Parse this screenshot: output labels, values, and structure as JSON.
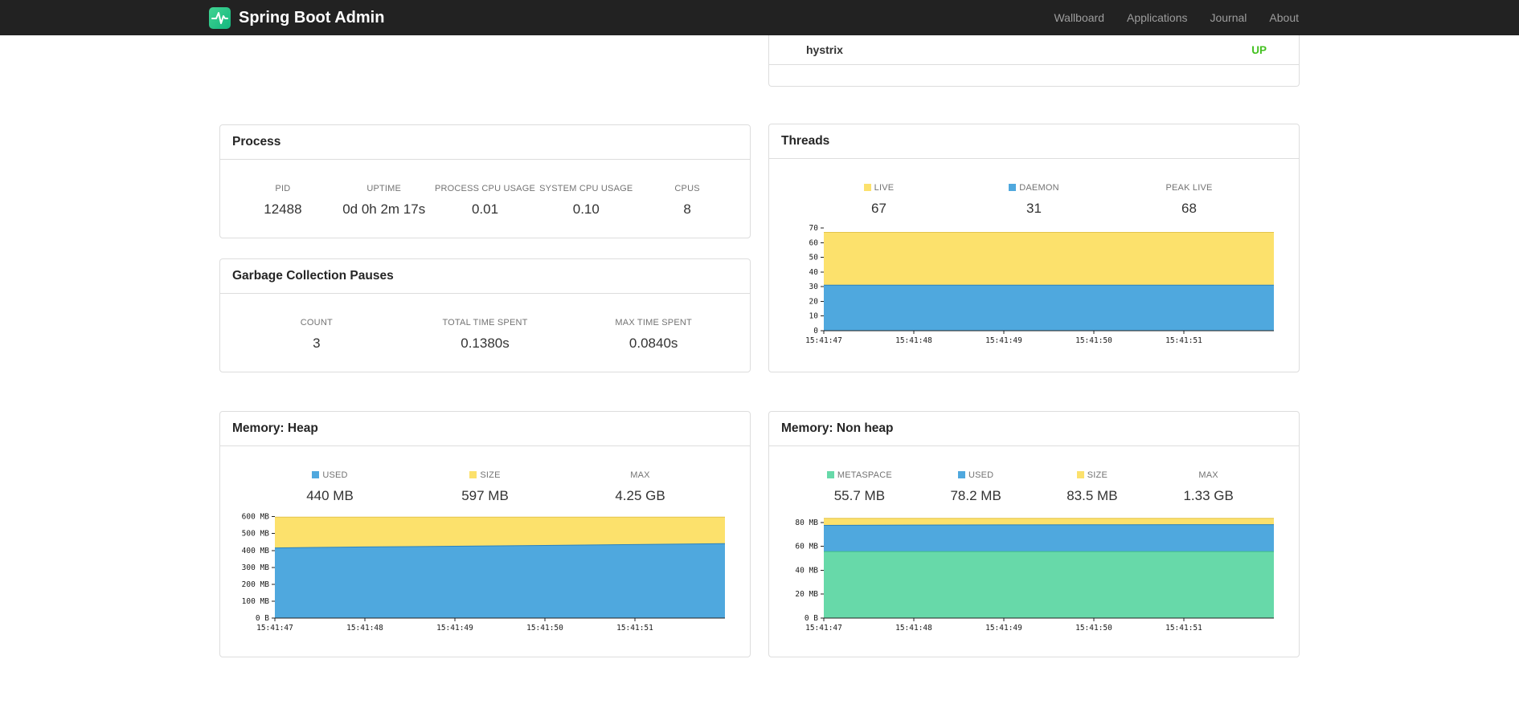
{
  "navbar": {
    "brand": "Spring Boot Admin",
    "items": [
      {
        "label": "Wallboard"
      },
      {
        "label": "Applications"
      },
      {
        "label": "Journal"
      },
      {
        "label": "About"
      }
    ]
  },
  "colors": {
    "brand_green": "#2bc48d",
    "status_up": "#43c120",
    "series_yellow": "#fce16c",
    "series_blue": "#4fa8de",
    "series_green": "#67d9a9"
  },
  "status_panel": {
    "service_name": "hystrix",
    "status": "UP"
  },
  "panels": {
    "process": {
      "title": "Process",
      "metrics": [
        {
          "label": "PID",
          "value": "12488"
        },
        {
          "label": "UPTIME",
          "value": "0d 0h 2m 17s"
        },
        {
          "label": "PROCESS CPU USAGE",
          "value": "0.01"
        },
        {
          "label": "SYSTEM CPU USAGE",
          "value": "0.10"
        },
        {
          "label": "CPUS",
          "value": "8"
        }
      ]
    },
    "gc": {
      "title": "Garbage Collection Pauses",
      "metrics": [
        {
          "label": "COUNT",
          "value": "3"
        },
        {
          "label": "TOTAL TIME SPENT",
          "value": "0.1380s"
        },
        {
          "label": "MAX TIME SPENT",
          "value": "0.0840s"
        }
      ]
    },
    "threads": {
      "title": "Threads",
      "legend": [
        {
          "label": "LIVE",
          "value": "67",
          "swatch": "#fce16c"
        },
        {
          "label": "DAEMON",
          "value": "31",
          "swatch": "#4fa8de"
        },
        {
          "label": "PEAK LIVE",
          "value": "68",
          "swatch": null
        }
      ]
    },
    "heap": {
      "title": "Memory: Heap",
      "legend": [
        {
          "label": "USED",
          "value": "440 MB",
          "swatch": "#4fa8de"
        },
        {
          "label": "SIZE",
          "value": "597 MB",
          "swatch": "#fce16c"
        },
        {
          "label": "MAX",
          "value": "4.25 GB",
          "swatch": null
        }
      ]
    },
    "nonheap": {
      "title": "Memory: Non heap",
      "legend": [
        {
          "label": "METASPACE",
          "value": "55.7 MB",
          "swatch": "#67d9a9"
        },
        {
          "label": "USED",
          "value": "78.2 MB",
          "swatch": "#4fa8de"
        },
        {
          "label": "SIZE",
          "value": "83.5 MB",
          "swatch": "#fce16c"
        },
        {
          "label": "MAX",
          "value": "1.33 GB",
          "swatch": null
        }
      ]
    }
  },
  "chart_data": [
    {
      "id": "threads",
      "type": "area",
      "title": "Threads",
      "stacked_visual": "layered absolute values, larger drawn behind",
      "x_ticks": [
        "15:41:47",
        "15:41:48",
        "15:41:49",
        "15:41:50",
        "15:41:51"
      ],
      "ylim": [
        0,
        70
      ],
      "y_ticks": [
        {
          "v": 0,
          "label": "0"
        },
        {
          "v": 10,
          "label": "10"
        },
        {
          "v": 20,
          "label": "20"
        },
        {
          "v": 30,
          "label": "30"
        },
        {
          "v": 40,
          "label": "40"
        },
        {
          "v": 50,
          "label": "50"
        },
        {
          "v": 60,
          "label": "60"
        },
        {
          "v": 70,
          "label": "70"
        }
      ],
      "series": [
        {
          "name": "LIVE",
          "fill": "#fce16c",
          "stroke": "#e4c44b",
          "values": [
            67,
            67,
            67,
            67,
            67,
            67
          ]
        },
        {
          "name": "DAEMON",
          "fill": "#4fa8de",
          "stroke": "#2c82bd",
          "values": [
            31,
            31,
            31,
            31,
            31,
            31
          ]
        }
      ]
    },
    {
      "id": "memory-heap",
      "type": "area",
      "title": "Memory: Heap",
      "stacked_visual": "layered absolute values, larger drawn behind",
      "x_ticks": [
        "15:41:47",
        "15:41:48",
        "15:41:49",
        "15:41:50",
        "15:41:51"
      ],
      "ylim": [
        0,
        608
      ],
      "y_ticks": [
        {
          "v": 0,
          "label": "0 B"
        },
        {
          "v": 100,
          "label": "100 MB"
        },
        {
          "v": 200,
          "label": "200 MB"
        },
        {
          "v": 300,
          "label": "300 MB"
        },
        {
          "v": 400,
          "label": "400 MB"
        },
        {
          "v": 500,
          "label": "500 MB"
        },
        {
          "v": 600,
          "label": "600 MB"
        }
      ],
      "series": [
        {
          "name": "SIZE",
          "fill": "#fce16c",
          "stroke": "#e4c44b",
          "values": [
            597,
            597,
            597,
            597,
            597,
            597
          ]
        },
        {
          "name": "USED",
          "fill": "#4fa8de",
          "stroke": "#2c82bd",
          "values": [
            415,
            421,
            425,
            430,
            435,
            441
          ]
        }
      ]
    },
    {
      "id": "memory-nonheap",
      "type": "area",
      "title": "Memory: Non heap",
      "stacked_visual": "layered absolute values, larger drawn behind",
      "x_ticks": [
        "15:41:47",
        "15:41:48",
        "15:41:49",
        "15:41:50",
        "15:41:51"
      ],
      "ylim": [
        0,
        86
      ],
      "y_ticks": [
        {
          "v": 0,
          "label": "0 B"
        },
        {
          "v": 20,
          "label": "20 MB"
        },
        {
          "v": 40,
          "label": "40 MB"
        },
        {
          "v": 60,
          "label": "60 MB"
        },
        {
          "v": 80,
          "label": "80 MB"
        }
      ],
      "series": [
        {
          "name": "SIZE",
          "fill": "#fce16c",
          "stroke": "#e4c44b",
          "values": [
            83.5,
            83.5,
            83.5,
            83.5,
            83.5,
            83.5
          ]
        },
        {
          "name": "USED",
          "fill": "#4fa8de",
          "stroke": "#2c82bd",
          "values": [
            77.6,
            77.9,
            78.0,
            78.1,
            78.2,
            78.2
          ]
        },
        {
          "name": "METASPACE",
          "fill": "#67d9a9",
          "stroke": "#3fbd8a",
          "values": [
            55.7,
            55.7,
            55.7,
            55.7,
            55.7,
            55.7
          ]
        }
      ]
    }
  ]
}
